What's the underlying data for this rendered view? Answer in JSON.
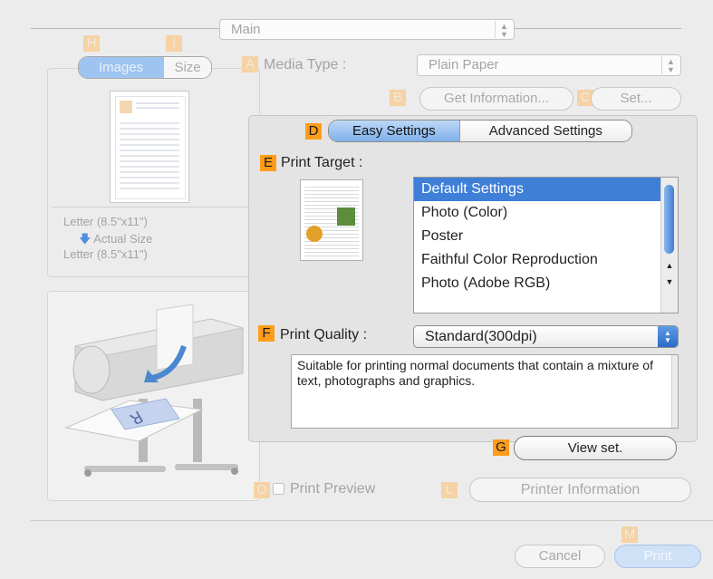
{
  "main_popup": {
    "label": "Main"
  },
  "preview_tabs": [
    {
      "label": "Images",
      "marker": "H"
    },
    {
      "label": "Size",
      "marker": "I"
    }
  ],
  "preview": {
    "original_size": "Letter (8.5\"x11\")",
    "scale_label": "Actual Size",
    "output_size": "Letter (8.5\"x11\")"
  },
  "media_type": {
    "marker": "A",
    "label": "Media Type :",
    "value": "Plain Paper"
  },
  "get_information": {
    "marker": "B",
    "label": "Get Information..."
  },
  "set_button": {
    "marker": "C",
    "label": "Set..."
  },
  "settings_tabs": {
    "marker": "D",
    "easy": "Easy Settings",
    "advanced": "Advanced Settings"
  },
  "print_target": {
    "marker": "E",
    "label": "Print Target :",
    "items": [
      "Default Settings",
      "Photo (Color)",
      "Poster",
      "Faithful Color Reproduction",
      "Photo (Adobe RGB)"
    ],
    "selected_index": 0
  },
  "print_quality": {
    "marker": "F",
    "label": "Print Quality :",
    "value": "Standard(300dpi)",
    "description": "Suitable for printing normal documents that contain a mixture of text, photographs and graphics."
  },
  "view_set": {
    "marker": "G",
    "label": "View set."
  },
  "print_preview": {
    "marker": "O",
    "label": "Print Preview",
    "checked": false
  },
  "printer_information": {
    "marker": "L",
    "label": "Printer Information"
  },
  "footer": {
    "marker": "M",
    "cancel": "Cancel",
    "print": "Print"
  },
  "colors": {
    "marker_bright": "#ff9d1b",
    "marker_faded": "#f6d2a4",
    "selection": "#3f7fd8",
    "tab_selected": "#9ec4f0"
  }
}
